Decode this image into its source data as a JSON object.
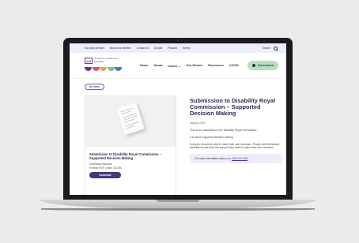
{
  "topbar": {
    "links": [
      "Our paid services",
      "Become a member",
      "Contact us",
      "Donate",
      "Podcast",
      "Events"
    ],
    "search_label": "Search",
    "search_icon": "search-icon"
  },
  "logo": {
    "abbr": "cid",
    "text": "Council for Intellectual Disability",
    "arc_colors": [
      "#5a3f8a",
      "#e1527a",
      "#f3a63b",
      "#7cc08b",
      "#3f7fc1"
    ]
  },
  "nav": {
    "items": [
      "Home",
      "About",
      "Issues ⌄",
      "Our Stories",
      "Resources",
      "COVID"
    ],
    "cta_label": "Get involved"
  },
  "breadcrumb": {
    "label": "All news"
  },
  "card": {
    "title": "Submission to Disability Royal Commission – Supported Decision Making",
    "subtitle": "Download resource",
    "meta": "Format: PDF  |  Size: 371 KB",
    "button_label": "Download"
  },
  "article": {
    "title": "Submission to Disability Royal Commission – Supported Decision Making",
    "date": "January 2022",
    "paragraphs": [
      "This is our submission to the Disability Royal Commission.",
      "It is about supported decision making.",
      "Everyone should be able to make their own decisions. People with intellectual disability should have the support they need to make their own decisions."
    ],
    "info_text": "For more information call us on",
    "info_link": "1800 424 065"
  },
  "colors": {
    "accent": "#4a3778",
    "cta": "#b6e0bf",
    "info_bg": "#edeefa",
    "topbar_bg": "#eceefa"
  }
}
